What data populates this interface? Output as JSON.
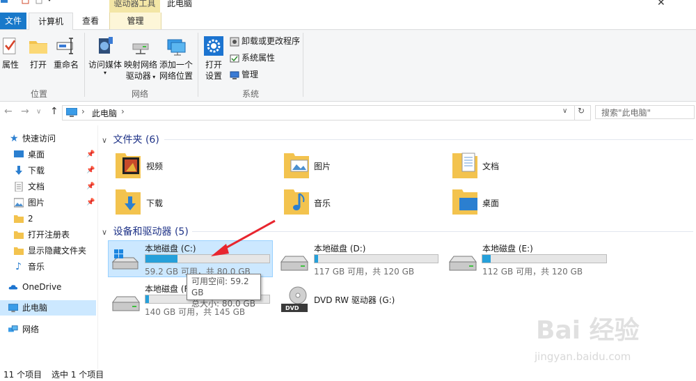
{
  "window": {
    "title": "此电脑",
    "context_tool": "驱动器工具",
    "close_glyph": "✕"
  },
  "ribbon_tabs": {
    "file": "文件",
    "computer": "计算机",
    "view": "查看",
    "manage": "管理"
  },
  "ribbon": {
    "location": {
      "label": "位置",
      "properties": "属性",
      "open": "打开",
      "rename": "重命名"
    },
    "network": {
      "label": "网络",
      "access_media": "访问媒体",
      "map_drive_1": "映射网络",
      "map_drive_2": "驱动器",
      "add_location_1": "添加一个",
      "add_location_2": "网络位置"
    },
    "system": {
      "label": "系统",
      "open_settings_1": "打开",
      "open_settings_2": "设置",
      "uninstall": "卸载或更改程序",
      "system_props": "系统属性",
      "manage": "管理"
    }
  },
  "address": {
    "location": "此电脑",
    "search_placeholder": "搜索\"此电脑\"",
    "back": "←",
    "forward": "→",
    "dropdown": "∨",
    "up": "↑",
    "chevron": "›",
    "refresh": "↻"
  },
  "nav": {
    "quick_access": "快速访问",
    "items": [
      "桌面",
      "下载",
      "文档",
      "图片",
      "2",
      "打开注册表",
      "显示隐藏文件夹",
      "音乐"
    ],
    "onedrive": "OneDrive",
    "this_pc": "此电脑",
    "network": "网络"
  },
  "folders_section": {
    "title": "文件夹 (6)",
    "items": [
      "视频",
      "图片",
      "文档",
      "下载",
      "音乐",
      "桌面"
    ]
  },
  "drives_section": {
    "title": "设备和驱动器 (5)",
    "drives": [
      {
        "name": "本地磁盘 (C:)",
        "free": "59.2 GB 可用，共 80.0 GB",
        "used_fraction": 0.26
      },
      {
        "name": "本地磁盘 (D:)",
        "free": "117 GB 可用，共 120 GB",
        "used_fraction": 0.03
      },
      {
        "name": "本地磁盘 (E:)",
        "free": "112 GB 可用，共 120 GB",
        "used_fraction": 0.07
      },
      {
        "name": "本地磁盘 (F:)",
        "free": "140 GB 可用，共 145 GB",
        "used_fraction": 0.03
      },
      {
        "name": "DVD RW 驱动器 (G:)"
      }
    ]
  },
  "tooltip": {
    "free_space": "可用空间: 59.2 GB",
    "total_size": "总大小: 80.0 GB"
  },
  "status": {
    "count": "11 个项目",
    "selected": "选中 1 个项目"
  },
  "watermark": {
    "main": "Bai 经验",
    "sub": "jingyan.baidu.com"
  },
  "colors": {
    "accent": "#1979ca",
    "selection": "#cce8ff",
    "bar_fill": "#26a0da",
    "section_title": "#1e3287",
    "arrow": "#e8262f"
  }
}
